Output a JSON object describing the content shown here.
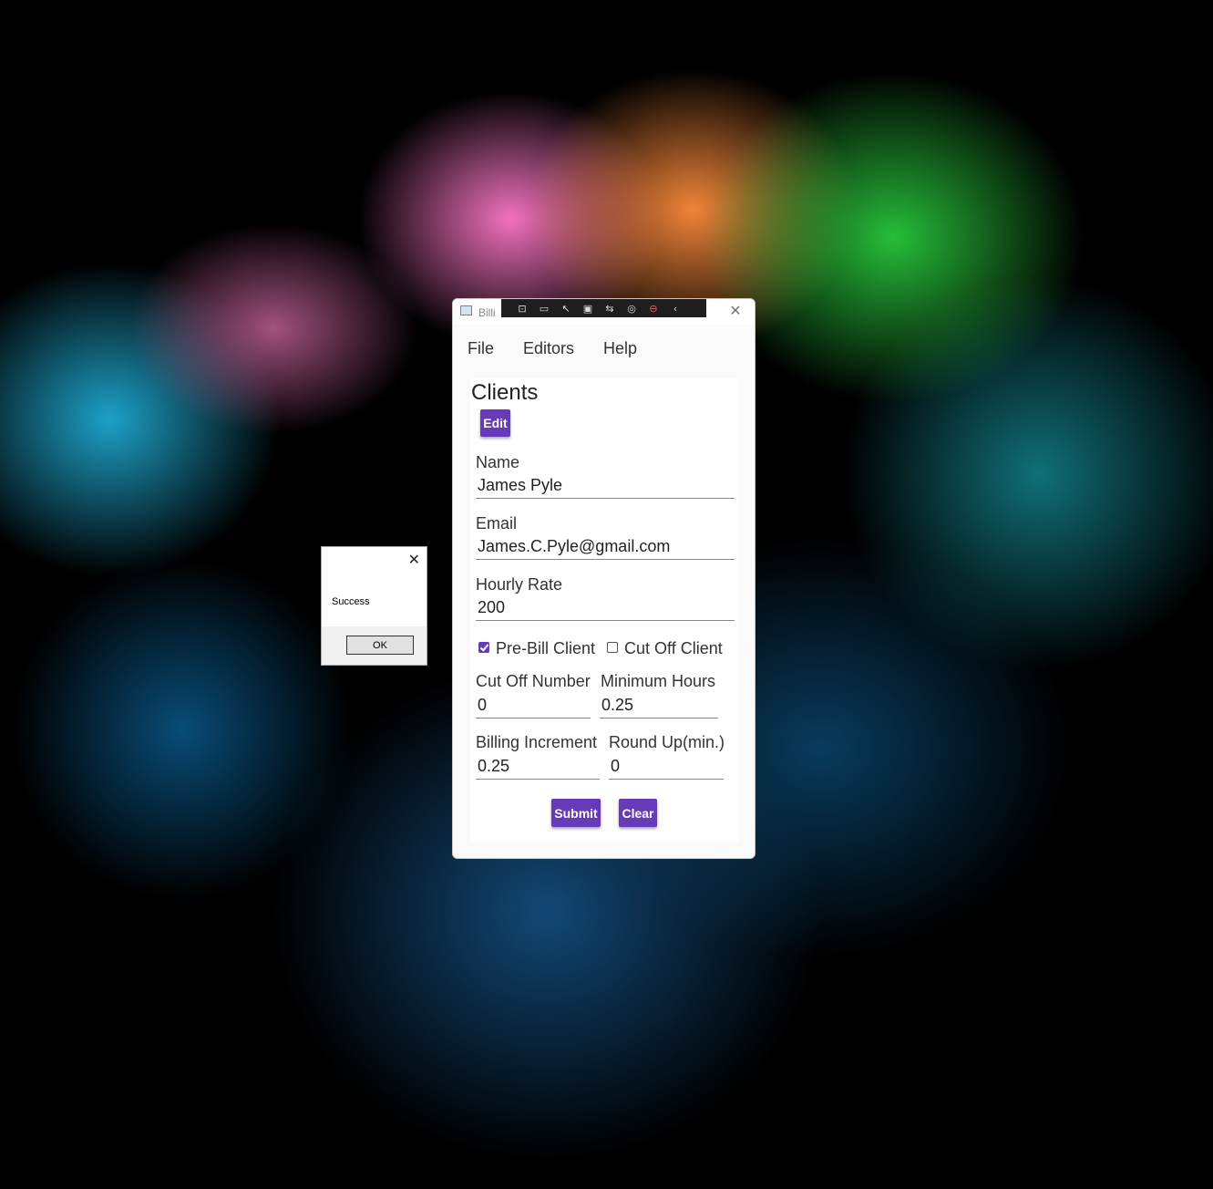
{
  "window": {
    "title": "Billi",
    "close_glyph": "✕",
    "toolbar_icons": [
      "select-element-icon",
      "record-icon",
      "pointer-icon",
      "frame-icon",
      "hot-reload-icon",
      "accessibility-icon",
      "stop-icon",
      "collapse-icon"
    ]
  },
  "menu": {
    "file": "File",
    "editors": "Editors",
    "help": "Help"
  },
  "form": {
    "heading": "Clients",
    "edit_label": "Edit",
    "name_label": "Name",
    "name_value": "James Pyle",
    "email_label": "Email",
    "email_value": "James.C.Pyle@gmail.com",
    "rate_label": "Hourly Rate",
    "rate_value": "200",
    "prebill_label": "Pre-Bill Client",
    "prebill_checked": true,
    "cutoff_client_label": "Cut Off Client",
    "cutoff_client_checked": false,
    "cutoff_number_label": "Cut Off Number",
    "cutoff_number_value": "0",
    "min_hours_label": "Minimum Hours",
    "min_hours_value": "0.25",
    "billing_increment_label": "Billing Increment",
    "billing_increment_value": "0.25",
    "round_up_label": "Round Up(min.)",
    "round_up_value": "0",
    "submit_label": "Submit",
    "clear_label": "Clear"
  },
  "message_box": {
    "text": "Success",
    "ok_label": "OK",
    "close_glyph": "✕"
  },
  "colors": {
    "accent": "#673ab7",
    "window_bg": "#fafafa"
  }
}
